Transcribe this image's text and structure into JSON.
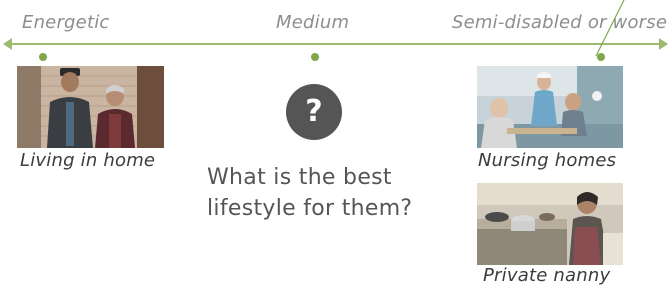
{
  "scale": {
    "left_label": "Energetic",
    "middle_label": "Medium",
    "right_label": "Semi-disabled or worse"
  },
  "options": [
    {
      "caption": "Living in home"
    },
    {
      "caption": "Nursing homes"
    },
    {
      "caption": "Private nanny"
    }
  ],
  "center": {
    "icon_symbol": "?",
    "question_line1": "What is the best",
    "question_line2": "lifestyle for them?"
  },
  "colors": {
    "axis": "#9fba6c",
    "dot": "#7fa84a",
    "question_circle": "#555555"
  }
}
